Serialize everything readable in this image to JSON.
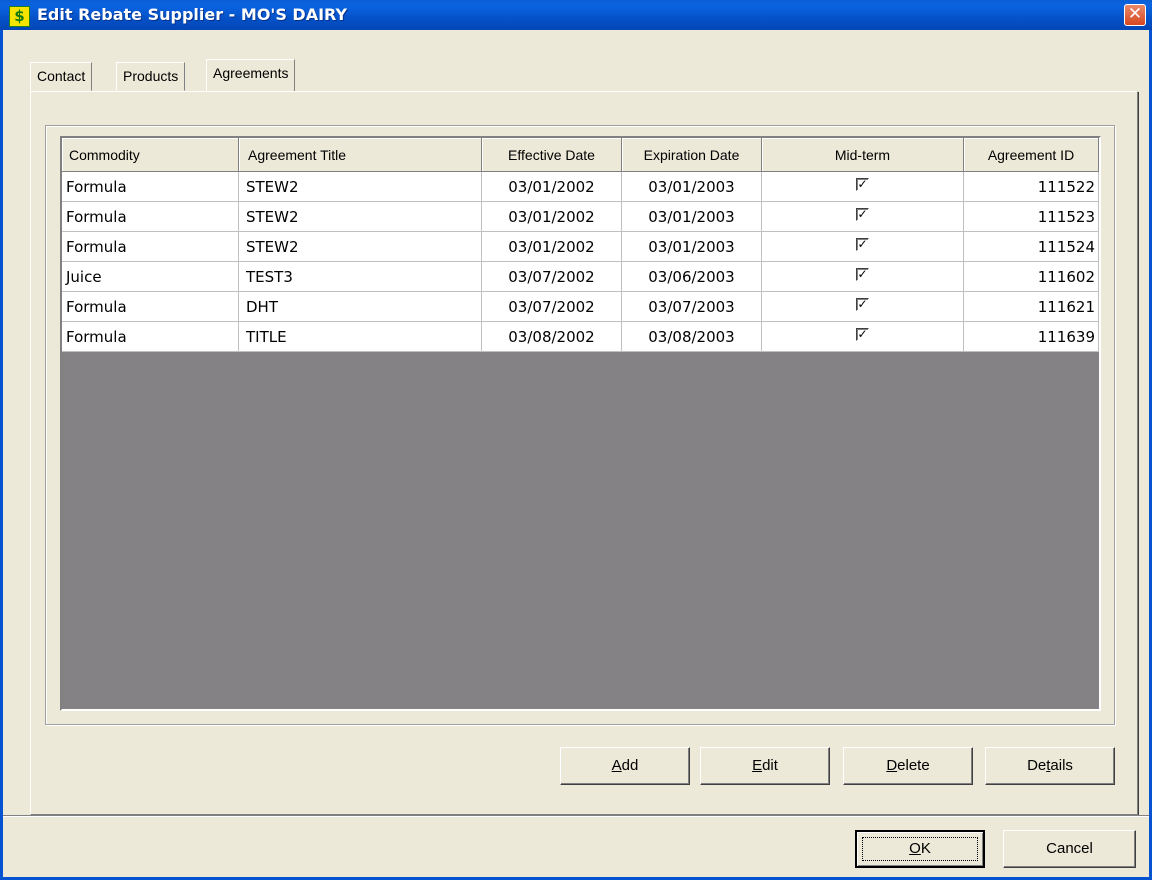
{
  "window": {
    "title": "Edit Rebate Supplier - MO'S DAIRY",
    "icon_glyph": "$",
    "close_glyph": "✕"
  },
  "tabs": [
    {
      "label": "Contact"
    },
    {
      "label": "Products"
    },
    {
      "label": "Agreements"
    }
  ],
  "active_tab": "Agreements",
  "grid": {
    "columns": [
      "Commodity",
      "Agreement Title",
      "Effective Date",
      "Expiration Date",
      "Mid-term",
      "Agreement ID"
    ],
    "rows": [
      {
        "commodity": "Formula",
        "title": "STEW2",
        "effective": "03/01/2002",
        "expiration": "03/01/2003",
        "midterm": true,
        "id": "111522"
      },
      {
        "commodity": "Formula",
        "title": "STEW2",
        "effective": "03/01/2002",
        "expiration": "03/01/2003",
        "midterm": true,
        "id": "111523"
      },
      {
        "commodity": "Formula",
        "title": "STEW2",
        "effective": "03/01/2002",
        "expiration": "03/01/2003",
        "midterm": true,
        "id": "111524"
      },
      {
        "commodity": "Juice",
        "title": "TEST3",
        "effective": "03/07/2002",
        "expiration": "03/06/2003",
        "midterm": true,
        "id": "111602"
      },
      {
        "commodity": "Formula",
        "title": "DHT",
        "effective": "03/07/2002",
        "expiration": "03/07/2003",
        "midterm": true,
        "id": "111621"
      },
      {
        "commodity": "Formula",
        "title": "TITLE",
        "effective": "03/08/2002",
        "expiration": "03/08/2003",
        "midterm": true,
        "id": "111639"
      }
    ]
  },
  "buttons": {
    "add": {
      "label": "Add",
      "accesskey": "A"
    },
    "edit": {
      "label": "Edit",
      "accesskey": "E"
    },
    "delete": {
      "label": "Delete",
      "accesskey": "D"
    },
    "details": {
      "label": "Details",
      "accesskey": "t"
    },
    "ok": {
      "label": "OK",
      "accesskey": "O"
    },
    "cancel": {
      "label": "Cancel"
    }
  },
  "colors": {
    "titlebar": "#0553d0",
    "dialog_bg": "#ece9d8",
    "grid_empty_bg": "#848284",
    "close_button": "#d8471f",
    "app_icon": "#f5e400"
  }
}
